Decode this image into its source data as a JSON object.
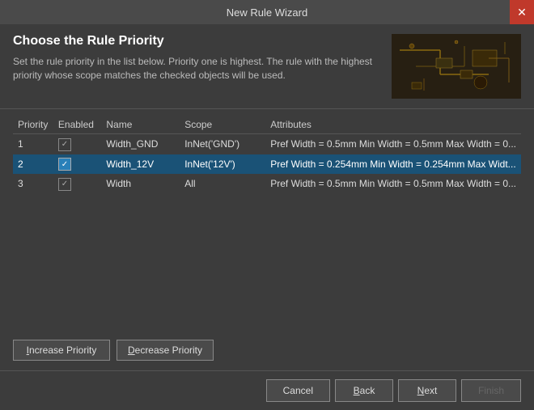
{
  "titleBar": {
    "title": "New Rule Wizard",
    "closeLabel": "✕"
  },
  "header": {
    "title": "Choose the Rule Priority",
    "description": "Set the rule priority in the list below. Priority one is highest. The rule with the highest priority whose scope matches the checked objects will be used."
  },
  "table": {
    "columns": [
      "Priority",
      "Enabled",
      "Name",
      "Scope",
      "Attributes"
    ],
    "rows": [
      {
        "priority": "1",
        "enabled": true,
        "name": "Width_GND",
        "scope": "InNet('GND')",
        "attributes": "Pref Width = 0.5mm    Min Width = 0.5mm    Max Width = 0..."
      },
      {
        "priority": "2",
        "enabled": true,
        "name": "Width_12V",
        "scope": "InNet('12V')",
        "attributes": "Pref Width = 0.254mm    Min Width = 0.254mm    Max Widt..."
      },
      {
        "priority": "3",
        "enabled": true,
        "name": "Width",
        "scope": "All",
        "attributes": "Pref Width = 0.5mm    Min Width = 0.5mm    Max Width = 0..."
      }
    ]
  },
  "priorityButtons": {
    "increase": "Increase Priority",
    "increase_underline": "I",
    "decrease": "Decrease Priority",
    "decrease_underline": "D"
  },
  "bottomButtons": {
    "cancel": "Cancel",
    "back": "Back",
    "back_underline": "B",
    "next": "Next",
    "next_underline": "N",
    "finish": "Finish"
  }
}
